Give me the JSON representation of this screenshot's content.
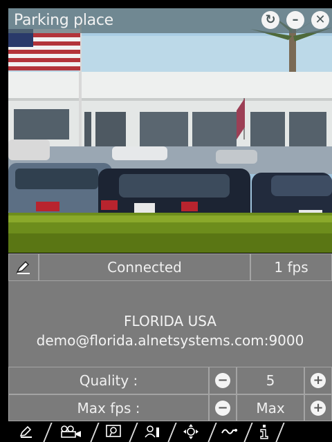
{
  "window": {
    "title": "Parking place",
    "buttons": {
      "refresh": "↻",
      "minimize": "–",
      "close": "✕"
    }
  },
  "status": {
    "connection": "Connected",
    "fps": "1 fps"
  },
  "camera_info": {
    "location": "FLORIDA USA",
    "address": "demo@florida.alnetsystems.com:9000"
  },
  "controls": {
    "quality": {
      "label": "Quality :",
      "value": "5",
      "minus": "−",
      "plus": "+"
    },
    "max_fps": {
      "label": "Max fps :",
      "value": "Max",
      "minus": "−",
      "plus": "+"
    }
  },
  "tabs": [
    "edit-icon",
    "camera-icon",
    "zoom-icon",
    "person-icon",
    "ptz-icon",
    "link-icon",
    "info-icon"
  ]
}
